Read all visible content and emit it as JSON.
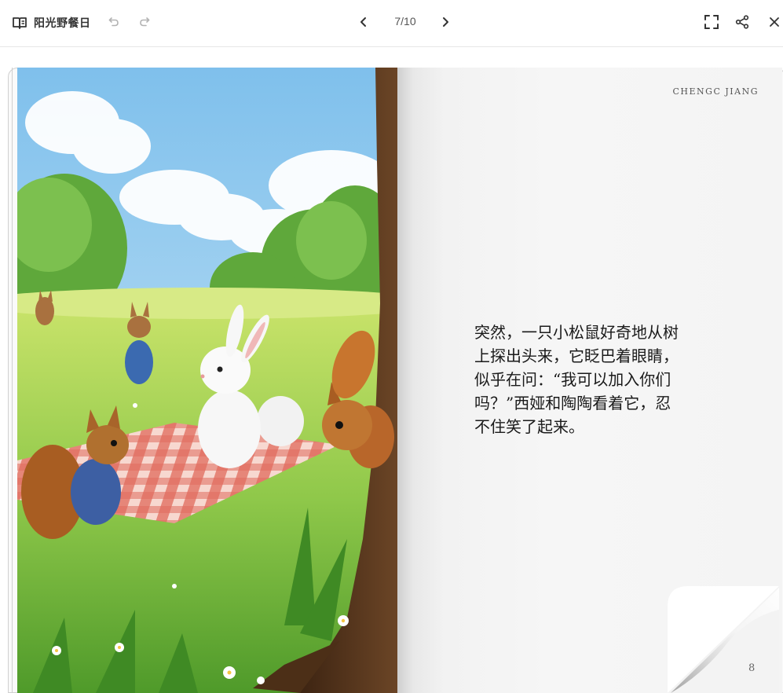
{
  "app": {
    "title": "阳光野餐日",
    "page_indicator": "7/10"
  },
  "icons": {
    "book": "book-open-icon",
    "undo": "undo-icon",
    "redo": "redo-icon",
    "prev": "chevron-left-icon",
    "next": "chevron-right-icon",
    "fullscreen": "fullscreen-icon",
    "share": "share-icon",
    "close": "close-icon"
  },
  "page": {
    "author": "CHENGC JIANG",
    "lines": [
      "突然，一只小松鼠好奇地从树",
      "上探出头来，它眨巴着眼睛，",
      "似乎在问：“我可以加入你们",
      "吗？”西娅和陶陶看着它，忍",
      "不住笑了起来。"
    ],
    "number": "8"
  },
  "colors": {
    "accent": "#333333",
    "disabled": "#b3b3b3"
  }
}
